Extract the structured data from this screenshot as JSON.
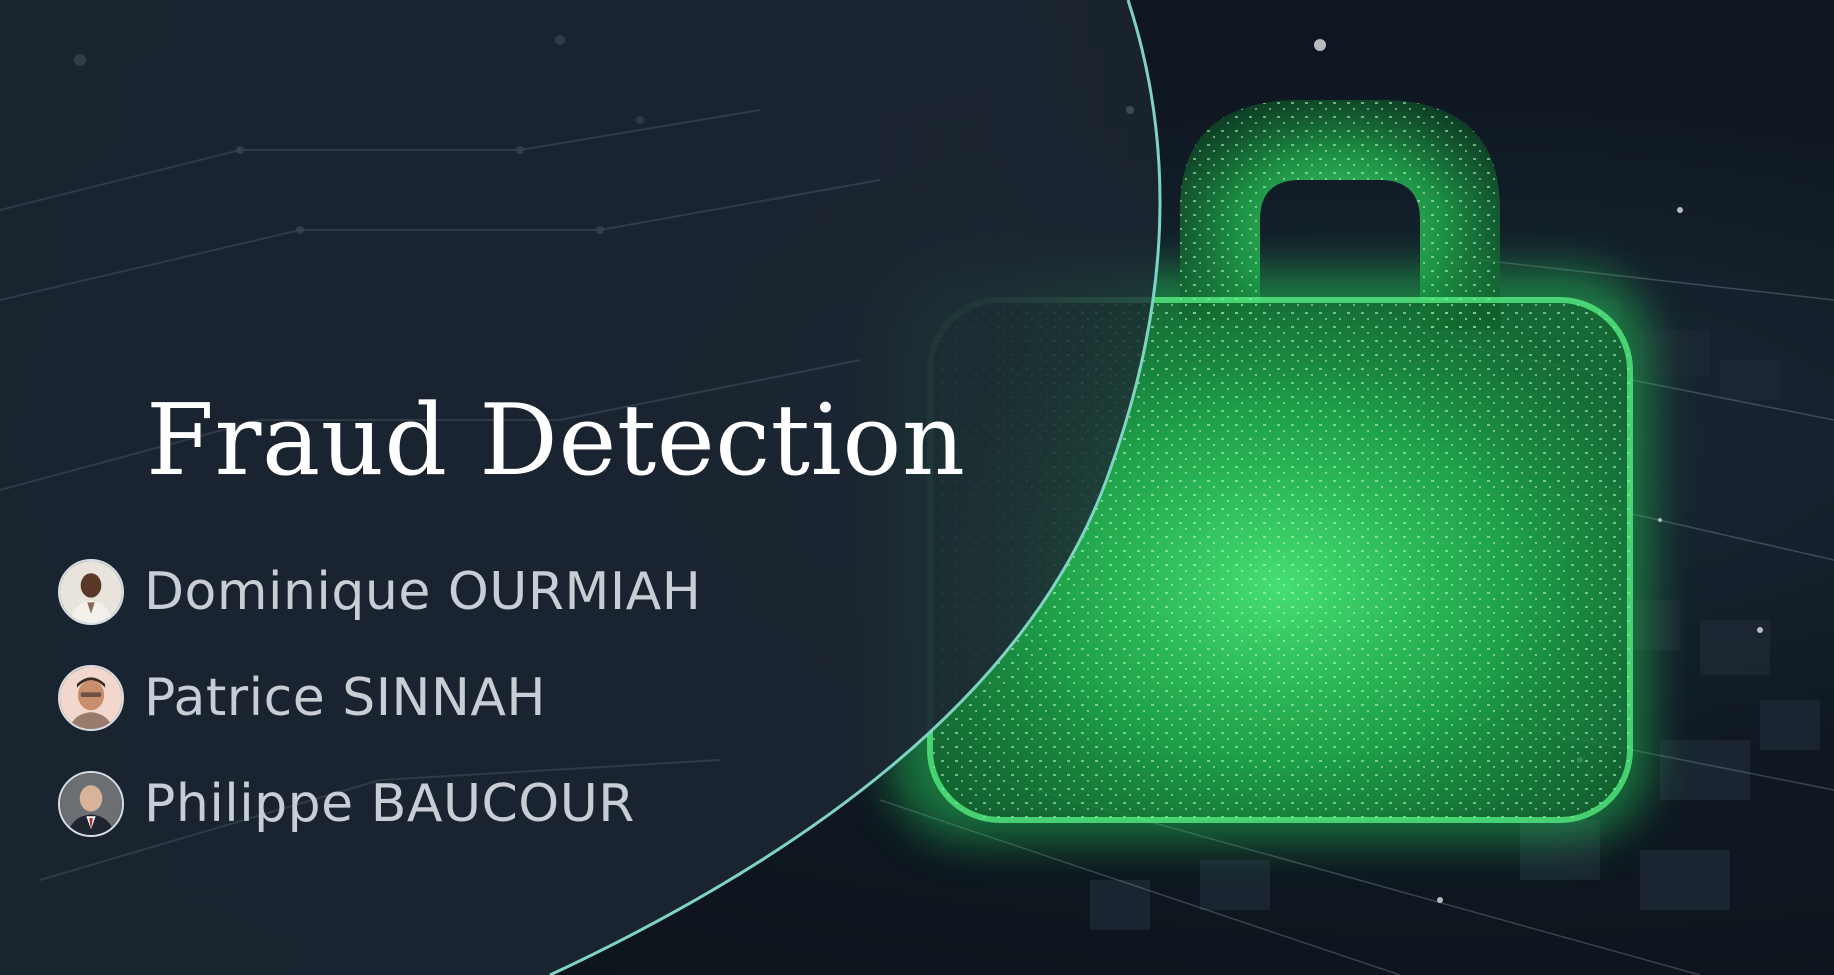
{
  "slide": {
    "title": "Fraud Detection",
    "authors": [
      {
        "name": "Dominique OURMIAH",
        "avatar_icon": "person-photo-icon"
      },
      {
        "name": "Patrice SINNAH",
        "avatar_icon": "person-photo-icon"
      },
      {
        "name": "Philippe BAUCOUR",
        "avatar_icon": "person-photo-icon"
      }
    ],
    "background_icon": "padlock-icon",
    "colors": {
      "accent_curve": "#7fd3c3",
      "lock_glow": "#34e06a",
      "panel": "#1a2430",
      "title_text": "#ffffff",
      "author_text": "#c8ced4"
    }
  }
}
